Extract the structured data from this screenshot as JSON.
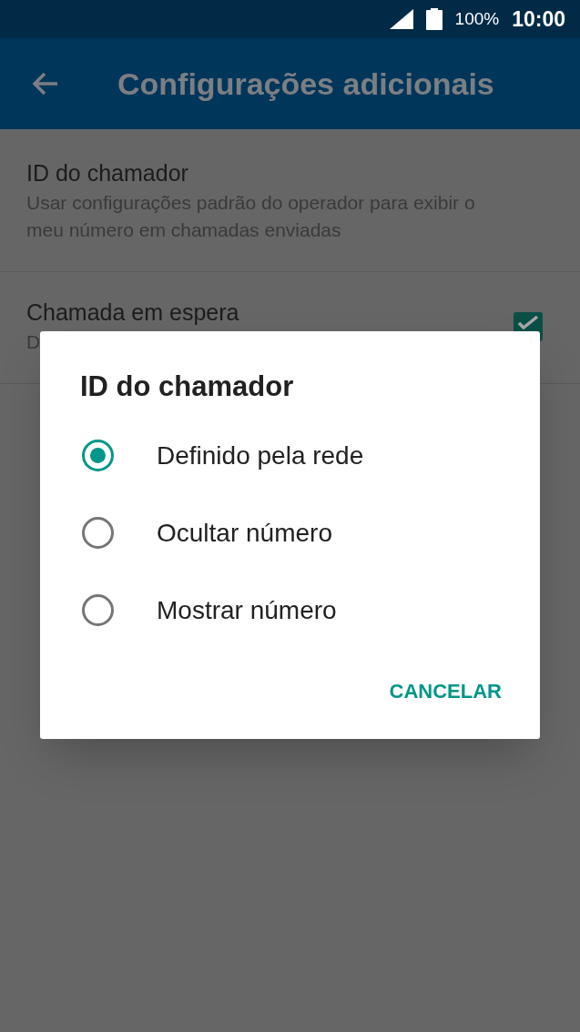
{
  "status_bar": {
    "battery": "100%",
    "time": "10:00"
  },
  "app_bar": {
    "title": "Configurações adicionais"
  },
  "settings": [
    {
      "kind": "text",
      "title": "ID do chamador",
      "subtitle": "Usar configurações padrão do operador para exibir o meu número em chamadas enviadas"
    },
    {
      "kind": "checkbox",
      "title": "Chamada em espera",
      "subtitle": "D",
      "checked": true
    }
  ],
  "dialog": {
    "title": "ID do chamador",
    "options": [
      {
        "label": "Definido pela rede",
        "selected": true
      },
      {
        "label": "Ocultar número",
        "selected": false
      },
      {
        "label": "Mostrar número",
        "selected": false
      }
    ],
    "buttons": [
      "CANCELAR"
    ]
  }
}
